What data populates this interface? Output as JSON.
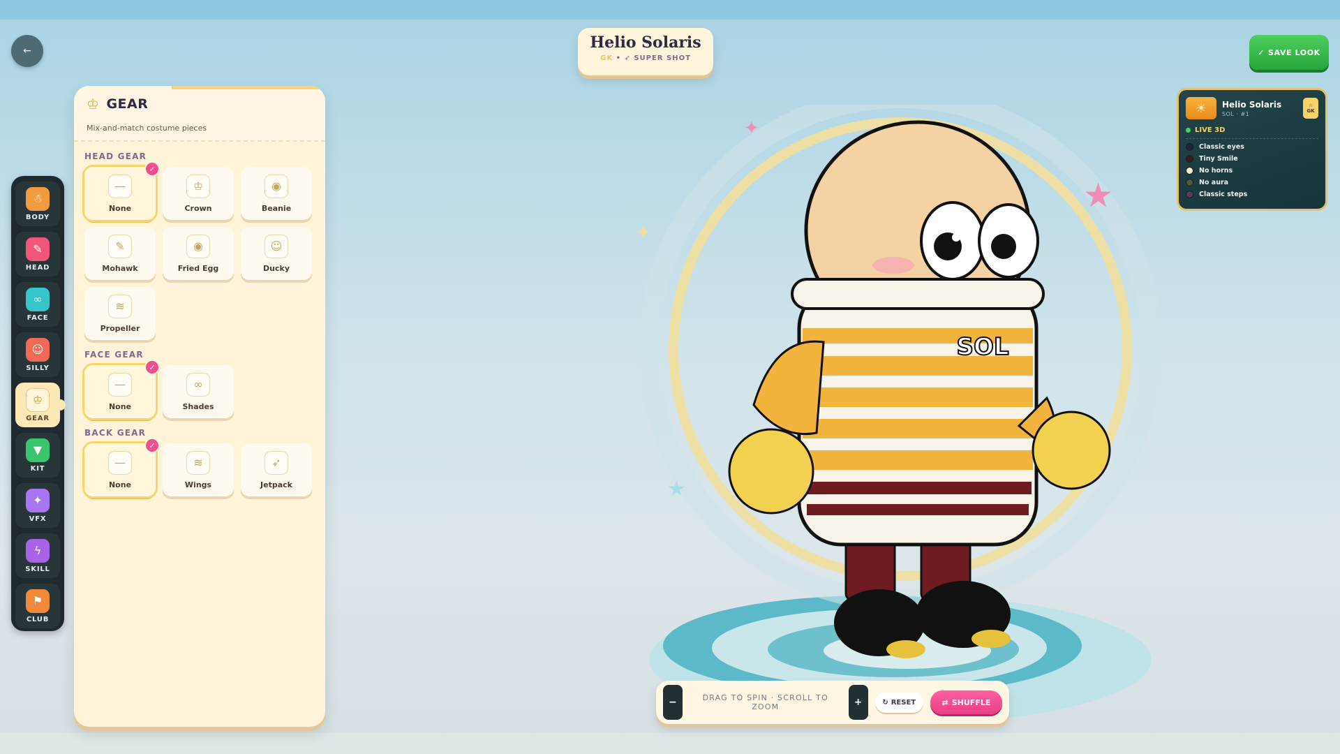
{
  "header": {
    "back_icon": "arrow-left-icon",
    "character_name": "Helio Solaris",
    "position": "GK",
    "separator": "•",
    "ability": "SUPER SHOT",
    "save_label": "SAVE LOOK"
  },
  "rail": {
    "items": [
      {
        "label": "BODY",
        "icon": "body-icon",
        "color": "#f29a3e"
      },
      {
        "label": "HEAD",
        "icon": "brush-icon",
        "color": "#f0567a"
      },
      {
        "label": "FACE",
        "icon": "glasses-icon",
        "color": "#38c5c9"
      },
      {
        "label": "SILLY",
        "icon": "smiley-icon",
        "color": "#f06a55"
      },
      {
        "label": "GEAR",
        "icon": "crown-icon",
        "color": "#f4d36b"
      },
      {
        "label": "KIT",
        "icon": "shirt-icon",
        "color": "#3cc56d"
      },
      {
        "label": "VFX",
        "icon": "sparkle-icon",
        "color": "#a877f0"
      },
      {
        "label": "SKILL",
        "icon": "bolt-icon",
        "color": "#a863e6"
      },
      {
        "label": "CLUB",
        "icon": "flag-icon",
        "color": "#f08a3a"
      }
    ]
  },
  "panel": {
    "title": "GEAR",
    "subtitle": "Mix-and-match costume pieces",
    "sections": [
      {
        "title": "HEAD GEAR",
        "items": [
          {
            "label": "None",
            "icon": "—",
            "selected": true
          },
          {
            "label": "Crown",
            "icon": "♔"
          },
          {
            "label": "Beanie",
            "icon": "◉"
          },
          {
            "label": "Mohawk",
            "icon": "✎"
          },
          {
            "label": "Fried Egg",
            "icon": "◉"
          },
          {
            "label": "Ducky",
            "icon": "☺"
          },
          {
            "label": "Propeller",
            "icon": "≋"
          }
        ]
      },
      {
        "title": "FACE GEAR",
        "items": [
          {
            "label": "None",
            "icon": "—",
            "selected": true
          },
          {
            "label": "Shades",
            "icon": "∞"
          }
        ]
      },
      {
        "title": "BACK GEAR",
        "items": [
          {
            "label": "None",
            "icon": "—",
            "selected": true
          },
          {
            "label": "Wings",
            "icon": "≋"
          },
          {
            "label": "Jetpack",
            "icon": "➶"
          }
        ]
      }
    ]
  },
  "live_card": {
    "name": "Helio Solaris",
    "sub": "SOL · #1",
    "pos": "GK",
    "status": "LIVE 3D",
    "traits": [
      {
        "label": "Classic eyes",
        "swatch": "#22223a"
      },
      {
        "label": "Tiny Smile",
        "swatch": "#3a1c16"
      },
      {
        "label": "No horns",
        "swatch": "#f6ecd0"
      },
      {
        "label": "No aura",
        "swatch": "#4e5a3e"
      },
      {
        "label": "Classic steps",
        "swatch": "#5a3a56"
      }
    ]
  },
  "character": {
    "jersey_text": "SOL",
    "colors": {
      "skin": "#f4d2a4",
      "stripe": "#f2b43c",
      "maroon": "#6e1c22",
      "hands": "#f2d150",
      "shoes": "#111111"
    }
  },
  "controls": {
    "zoom_out": "−",
    "zoom_in": "+",
    "hint": "DRAG TO SPIN · SCROLL TO ZOOM",
    "reset_label": "RESET",
    "shuffle_label": "SHUFFLE"
  }
}
